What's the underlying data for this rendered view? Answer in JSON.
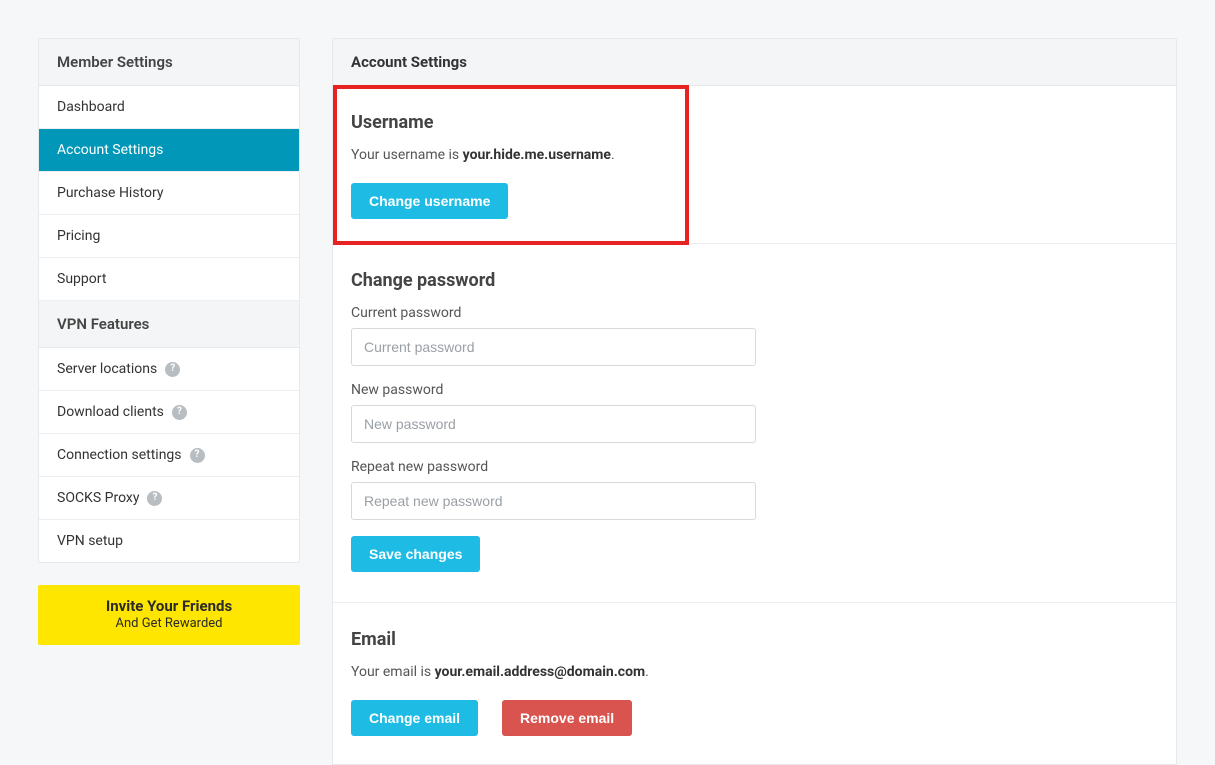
{
  "sidebar": {
    "header1": "Member Settings",
    "items1": [
      {
        "label": "Dashboard"
      },
      {
        "label": "Account Settings",
        "active": true
      },
      {
        "label": "Purchase History"
      },
      {
        "label": "Pricing"
      },
      {
        "label": "Support"
      }
    ],
    "header2": "VPN Features",
    "items2": [
      {
        "label": "Server locations",
        "help": true
      },
      {
        "label": "Download clients",
        "help": true
      },
      {
        "label": "Connection settings",
        "help": true
      },
      {
        "label": "SOCKS Proxy",
        "help": true
      },
      {
        "label": "VPN setup"
      }
    ]
  },
  "invite": {
    "title": "Invite Your Friends",
    "sub": "And Get Rewarded"
  },
  "main": {
    "header": "Account Settings",
    "username": {
      "heading": "Username",
      "prefix": "Your username is ",
      "value": "your.hide.me.username",
      "suffix": ".",
      "change_btn": "Change username"
    },
    "password": {
      "heading": "Change password",
      "current_label": "Current password",
      "current_placeholder": "Current password",
      "new_label": "New password",
      "new_placeholder": "New password",
      "repeat_label": "Repeat new password",
      "repeat_placeholder": "Repeat new password",
      "save_btn": "Save changes"
    },
    "email": {
      "heading": "Email",
      "prefix": "Your email is ",
      "value": "your.email.address@domain.com",
      "suffix": ".",
      "change_btn": "Change email",
      "remove_btn": "Remove email"
    }
  }
}
